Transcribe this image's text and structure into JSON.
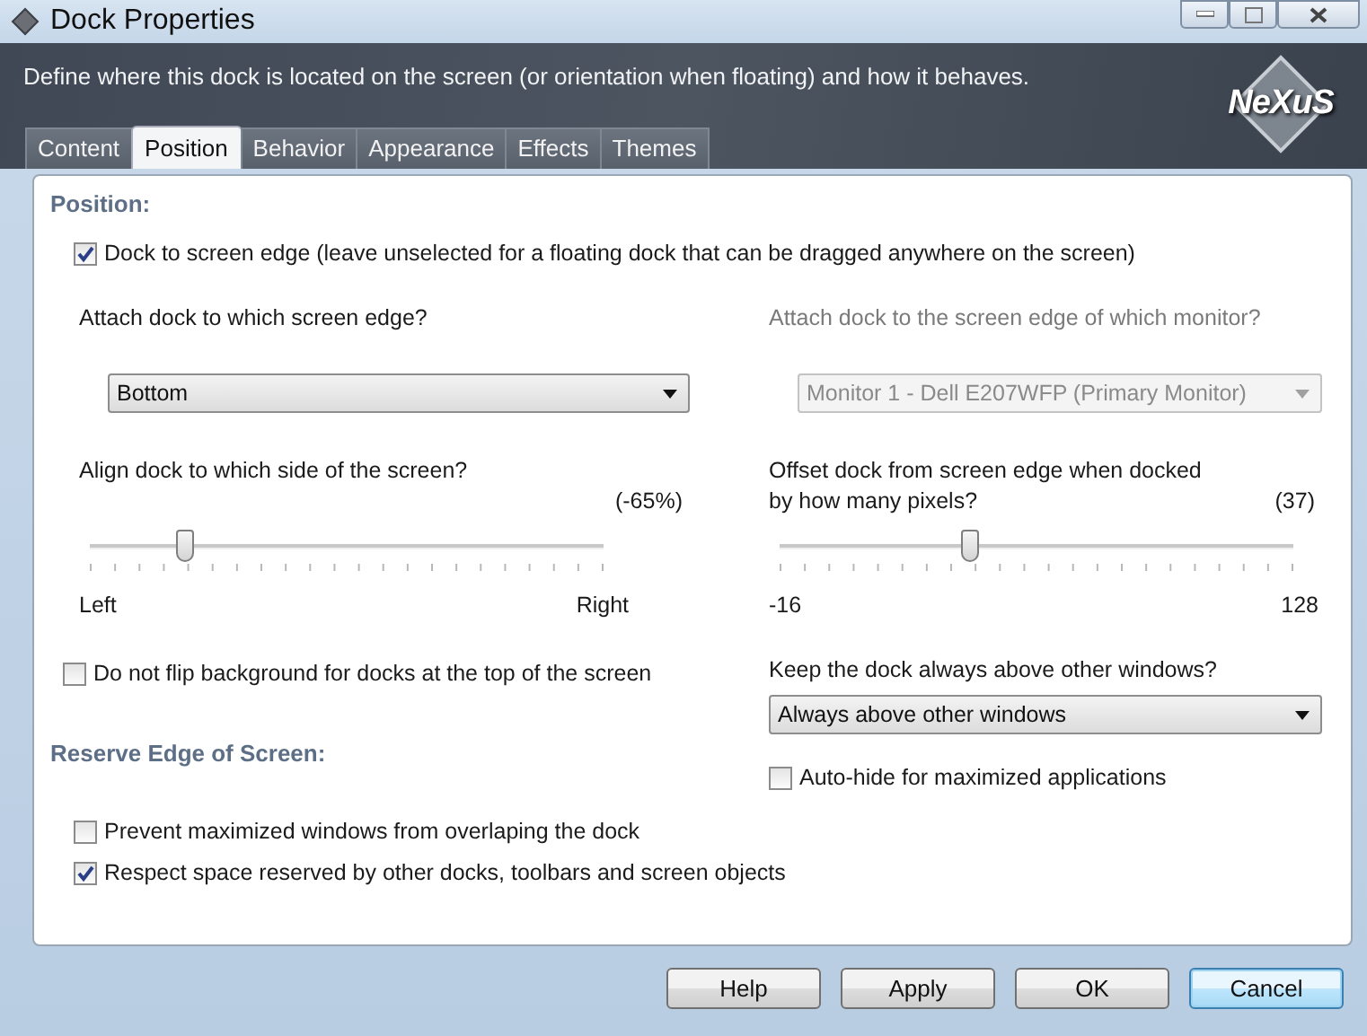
{
  "window": {
    "title": "Dock Properties"
  },
  "header": {
    "description": "Define where this dock is located on the screen (or orientation when floating) and how it behaves.",
    "logo": "NeXuS"
  },
  "tabs": [
    {
      "label": "Content",
      "selected": false
    },
    {
      "label": "Position",
      "selected": true
    },
    {
      "label": "Behavior",
      "selected": false
    },
    {
      "label": "Appearance",
      "selected": false
    },
    {
      "label": "Effects",
      "selected": false
    },
    {
      "label": "Themes",
      "selected": false
    }
  ],
  "position": {
    "heading": "Position:",
    "dock_to_edge": {
      "label": "Dock to screen edge (leave unselected for a floating dock that can be dragged anywhere on the screen)",
      "checked": true
    },
    "edge": {
      "label": "Attach dock to which screen edge?",
      "value": "Bottom",
      "disabled": false
    },
    "monitor": {
      "label": "Attach dock to the screen edge of which monitor?",
      "value": "Monitor 1 - Dell E207WFP (Primary Monitor)",
      "disabled": true
    },
    "align": {
      "label_lines": [
        "Align dock to which side of the screen?"
      ],
      "reading": "(-65%)",
      "level": 0.185,
      "min_label": "Left",
      "max_label": "Right"
    },
    "offset": {
      "label_lines": [
        "Offset dock from screen edge when docked",
        "by how many pixels?"
      ],
      "reading": "(37)",
      "level": 0.37,
      "min_label": "-16",
      "max_label": "128"
    },
    "no_flip": {
      "label": "Do not flip background for docks at the top of the screen",
      "checked": false
    },
    "above": {
      "label": "Keep the dock always above other windows?",
      "value": "Always above other windows",
      "disabled": false
    },
    "autohide": {
      "label": "Auto-hide for maximized applications",
      "checked": false
    }
  },
  "reserve": {
    "heading": "Reserve Edge of Screen:",
    "options": [
      {
        "label": "Prevent maximized windows from overlaping the dock",
        "checked": false
      },
      {
        "label": "Respect space reserved by other docks, toolbars and screen objects",
        "checked": true
      }
    ]
  },
  "buttons": [
    {
      "label": "Help",
      "focused": false
    },
    {
      "label": "Apply",
      "focused": false
    },
    {
      "label": "OK",
      "focused": false
    },
    {
      "label": "Cancel",
      "focused": true
    }
  ]
}
